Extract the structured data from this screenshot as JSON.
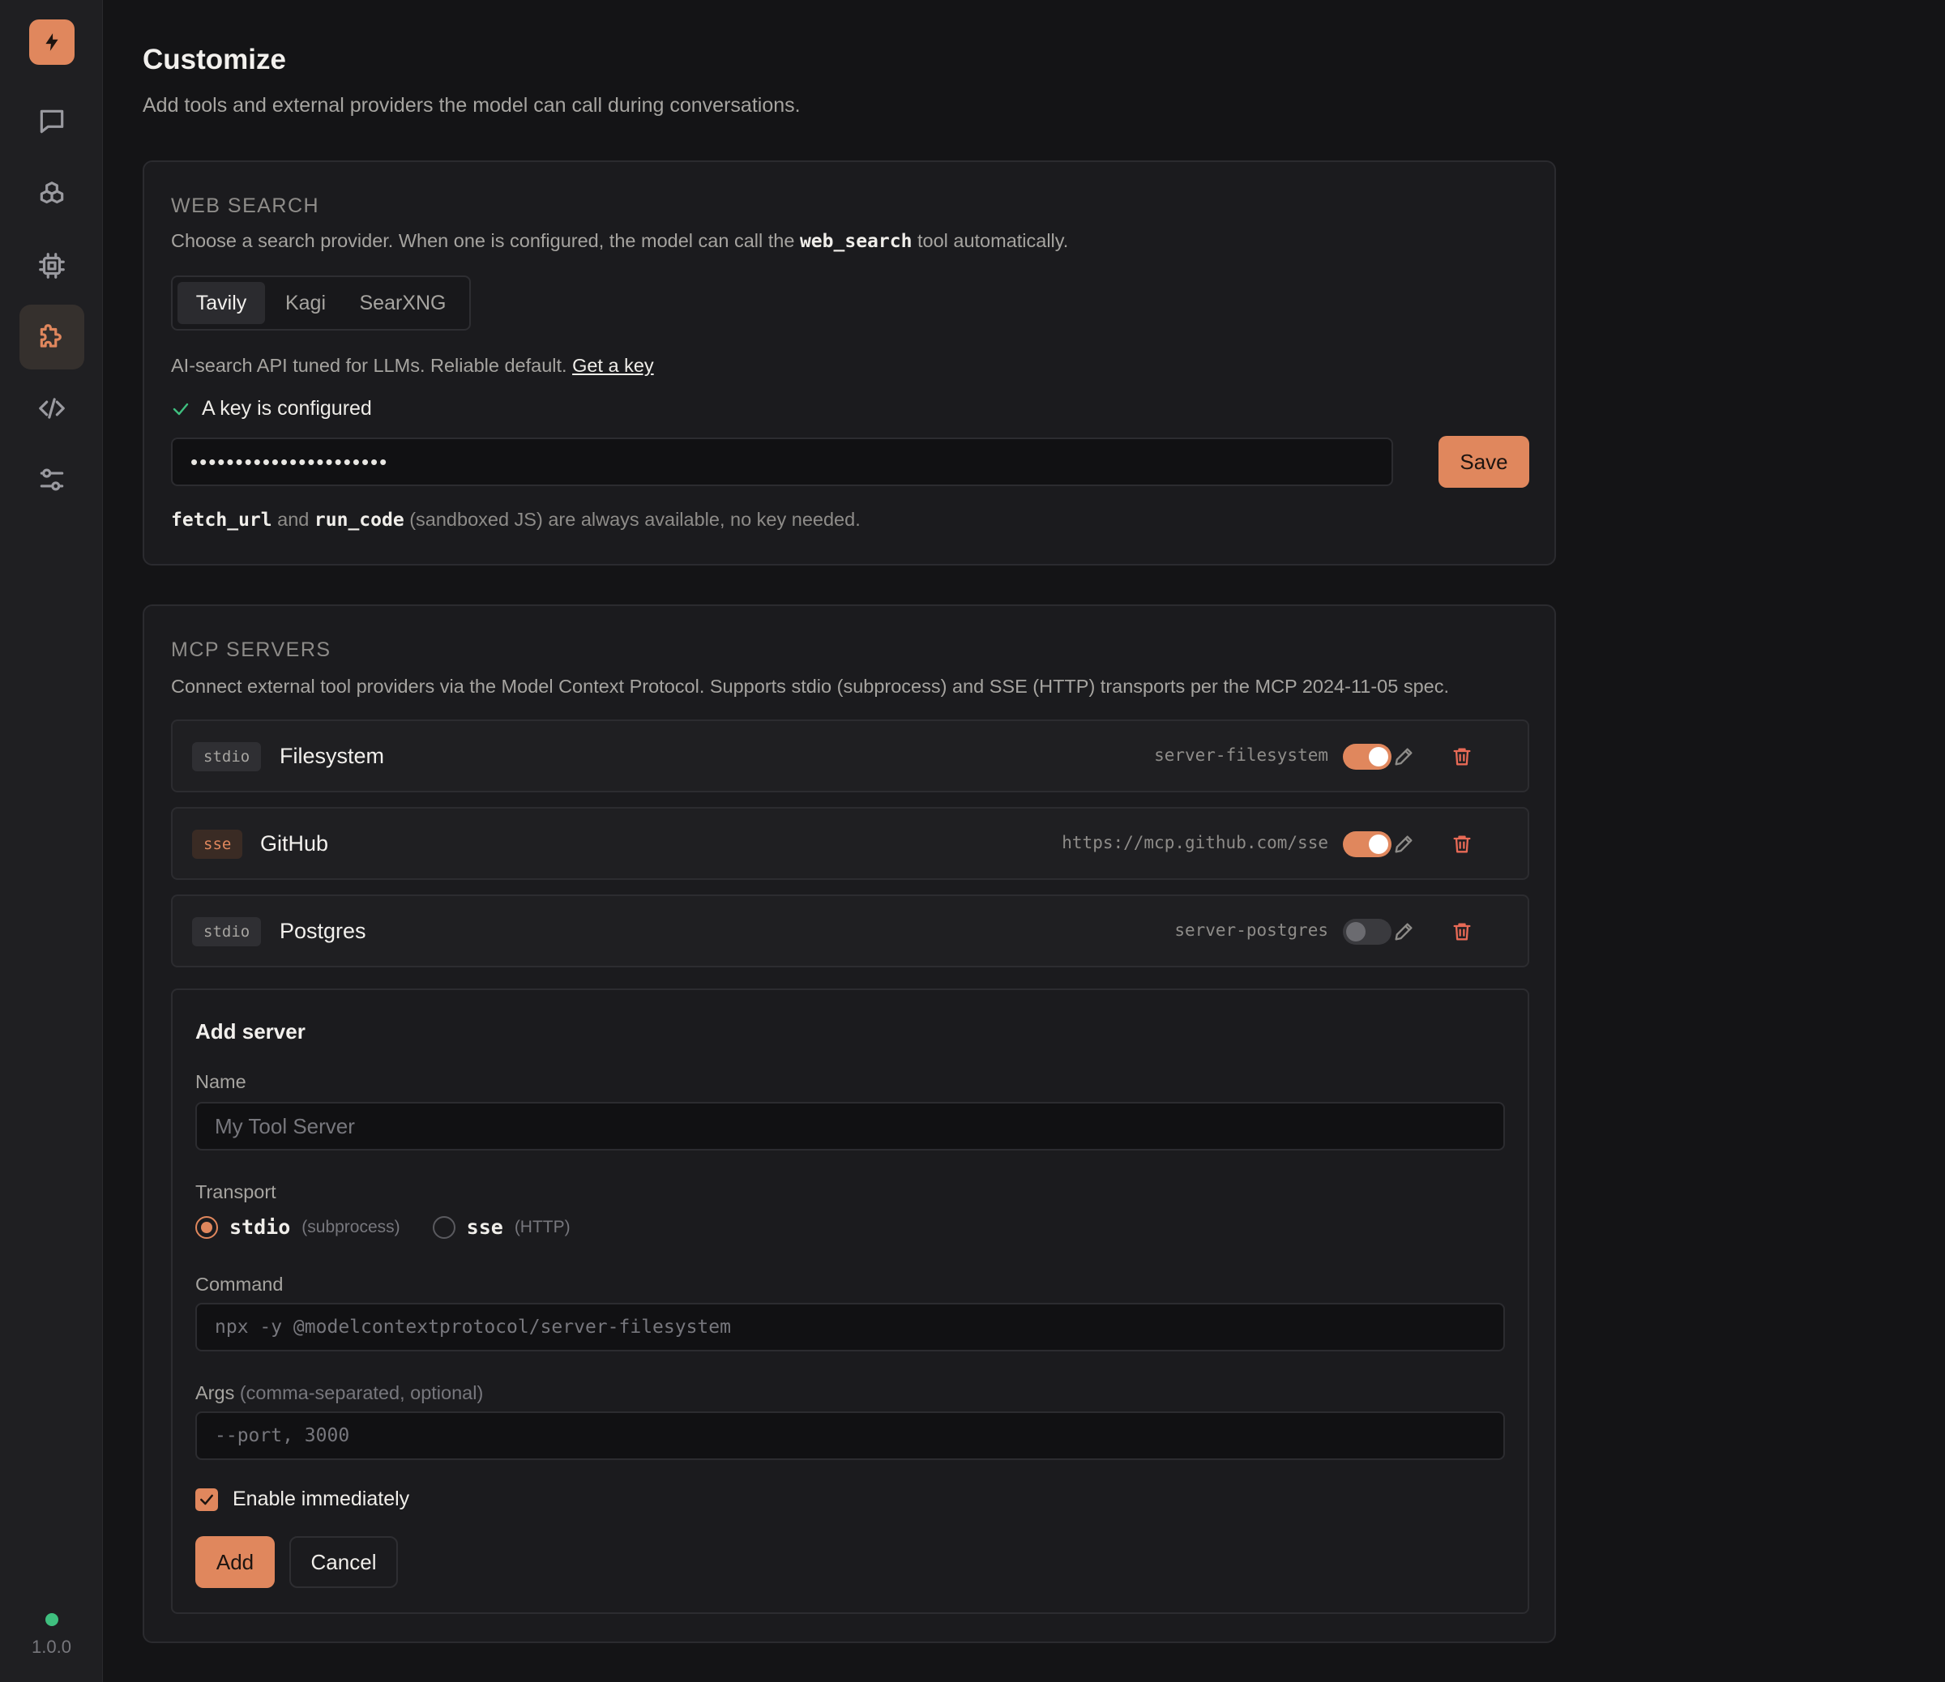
{
  "app": {
    "version": "1.0.0"
  },
  "colors": {
    "accent": "#e0875d",
    "status_ok": "#3fbf7f",
    "danger": "#e86a56"
  },
  "sidebar": {
    "items": [
      {
        "icon": "bolt-icon"
      },
      {
        "icon": "chat-icon"
      },
      {
        "icon": "cubes-icon"
      },
      {
        "icon": "chip-icon"
      },
      {
        "icon": "puzzle-icon",
        "active": true
      },
      {
        "icon": "code-icon"
      },
      {
        "icon": "sliders-icon"
      }
    ]
  },
  "header": {
    "title": "Customize",
    "subtitle": "Add tools and external providers the model can call during conversations."
  },
  "web_search": {
    "title": "WEB SEARCH",
    "desc_before": "Choose a search provider. When one is configured, the model can call the ",
    "desc_code": "web_search",
    "desc_after": " tool automatically.",
    "providers": [
      "Tavily",
      "Kagi",
      "SearXNG"
    ],
    "selected_provider": "Tavily",
    "provider_desc": "AI-search API tuned for LLMs. Reliable default.",
    "provider_link": "Get a key",
    "key_status": "A key is configured",
    "key_value": "••••••••••••••••••••••",
    "save_label": "Save",
    "foot_code1": "fetch_url",
    "foot_and": " and ",
    "foot_code2": "run_code",
    "foot_rest": " (sandboxed JS) are always available, no key needed."
  },
  "mcp": {
    "title": "MCP SERVERS",
    "desc": "Connect external tool providers via the Model Context Protocol. Supports stdio (subprocess) and SSE (HTTP) transports per the MCP 2024-11-05 spec.",
    "servers": [
      {
        "transport": "stdio",
        "name": "Filesystem",
        "target": "server-filesystem",
        "enabled": true
      },
      {
        "transport": "sse",
        "name": "GitHub",
        "target": "https://mcp.github.com/sse",
        "enabled": true
      },
      {
        "transport": "stdio",
        "name": "Postgres",
        "target": "server-postgres",
        "enabled": false
      }
    ],
    "add_form": {
      "title": "Add server",
      "name_label": "Name",
      "name_placeholder": "My Tool Server",
      "transport_label": "Transport",
      "transport_options": [
        {
          "label": "stdio",
          "hint": "(subprocess)",
          "checked": true
        },
        {
          "label": "sse",
          "hint": "(HTTP)",
          "checked": false
        }
      ],
      "command_label": "Command",
      "command_placeholder": "npx -y @modelcontextprotocol/server-filesystem",
      "args_label": "Args",
      "args_hint": "(comma-separated, optional)",
      "args_placeholder": "--port, 3000",
      "enable_label": "Enable immediately",
      "enable_checked": true,
      "add_label": "Add",
      "cancel_label": "Cancel"
    }
  }
}
